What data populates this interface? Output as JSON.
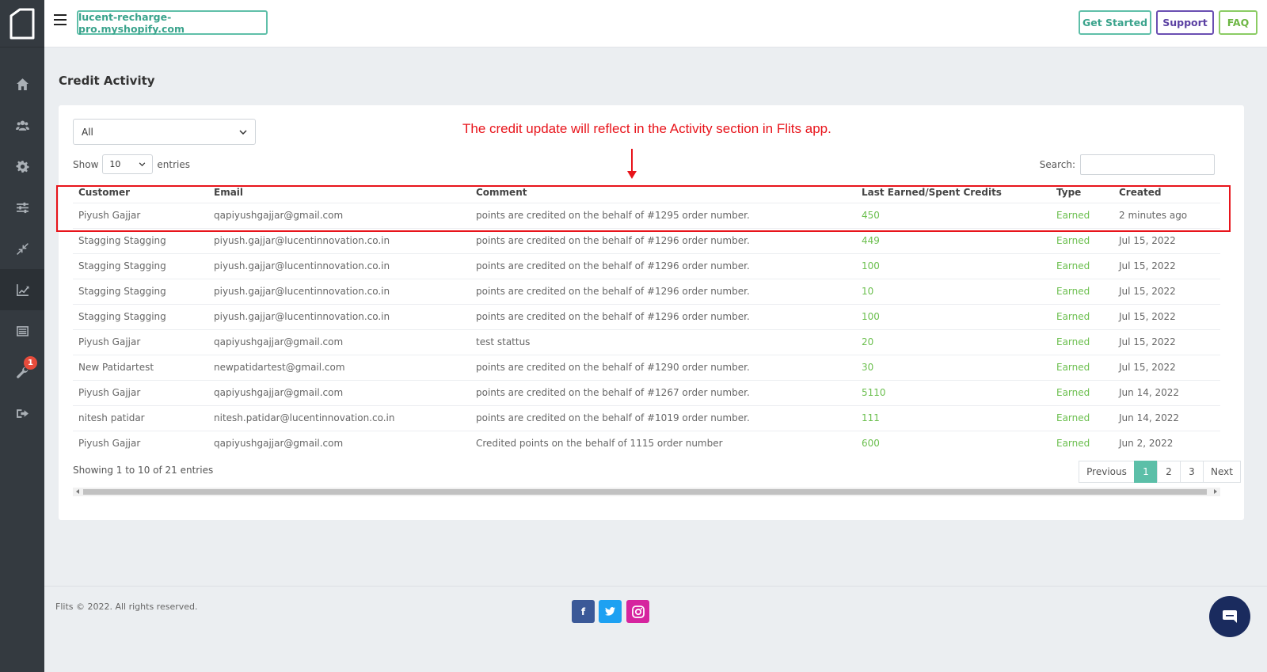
{
  "header": {
    "store": "lucent-recharge-pro.myshopify.com",
    "get_started": "Get Started",
    "support": "Support",
    "faq": "FAQ"
  },
  "sidebar": {
    "items": [
      {
        "icon": "home-icon"
      },
      {
        "icon": "users-icon"
      },
      {
        "icon": "gear-icon"
      },
      {
        "icon": "sliders-icon"
      },
      {
        "icon": "compress-icon"
      },
      {
        "icon": "chart-line-icon",
        "active": true
      },
      {
        "icon": "list-icon"
      },
      {
        "icon": "wrench-icon",
        "badge": "1"
      },
      {
        "icon": "sign-out-icon"
      }
    ]
  },
  "page": {
    "title": "Credit Activity",
    "filter": "All",
    "annotation": "The credit update will reflect in the Activity section in Flits app.",
    "show_label": "Show",
    "entries_value": "10",
    "entries_label": "entries",
    "search_label": "Search:"
  },
  "table": {
    "columns": [
      "Customer",
      "Email",
      "Comment",
      "Last Earned/Spent Credits",
      "Type",
      "Created"
    ],
    "rows": [
      [
        "Piyush Gajjar",
        "qapiyushgajjar@gmail.com",
        "points are credited on the behalf of #1295 order number.",
        "450",
        "Earned",
        "2 minutes ago"
      ],
      [
        "Stagging Stagging",
        "piyush.gajjar@lucentinnovation.co.in",
        "points are credited on the behalf of #1296 order number.",
        "449",
        "Earned",
        "Jul 15, 2022"
      ],
      [
        "Stagging Stagging",
        "piyush.gajjar@lucentinnovation.co.in",
        "points are credited on the behalf of #1296 order number.",
        "100",
        "Earned",
        "Jul 15, 2022"
      ],
      [
        "Stagging Stagging",
        "piyush.gajjar@lucentinnovation.co.in",
        "points are credited on the behalf of #1296 order number.",
        "10",
        "Earned",
        "Jul 15, 2022"
      ],
      [
        "Stagging Stagging",
        "piyush.gajjar@lucentinnovation.co.in",
        "points are credited on the behalf of #1296 order number.",
        "100",
        "Earned",
        "Jul 15, 2022"
      ],
      [
        "Piyush Gajjar",
        "qapiyushgajjar@gmail.com",
        "test stattus",
        "20",
        "Earned",
        "Jul 15, 2022"
      ],
      [
        "New Patidartest",
        "newpatidartest@gmail.com",
        "points are credited on the behalf of #1290 order number.",
        "30",
        "Earned",
        "Jul 15, 2022"
      ],
      [
        "Piyush Gajjar",
        "qapiyushgajjar@gmail.com",
        "points are credited on the behalf of #1267 order number.",
        "5110",
        "Earned",
        "Jun 14, 2022"
      ],
      [
        "nitesh patidar",
        "nitesh.patidar@lucentinnovation.co.in",
        "points are credited on the behalf of #1019 order number.",
        "111",
        "Earned",
        "Jun 14, 2022"
      ],
      [
        "Piyush Gajjar",
        "qapiyushgajjar@gmail.com",
        "Credited points on the behalf of 1115 order number",
        "600",
        "Earned",
        "Jun 2, 2022"
      ]
    ],
    "info": "Showing 1 to 10 of 21 entries"
  },
  "pagination": {
    "previous": "Previous",
    "pages": [
      "1",
      "2",
      "3"
    ],
    "next": "Next"
  },
  "footer": {
    "copyright": "Flits © 2022. All rights reserved.",
    "facebook": "f",
    "twitter": "t"
  },
  "colors": {
    "accent": "#5cbfa8",
    "credit_green": "#6bbf4e",
    "annotation_red": "#e8141b"
  }
}
